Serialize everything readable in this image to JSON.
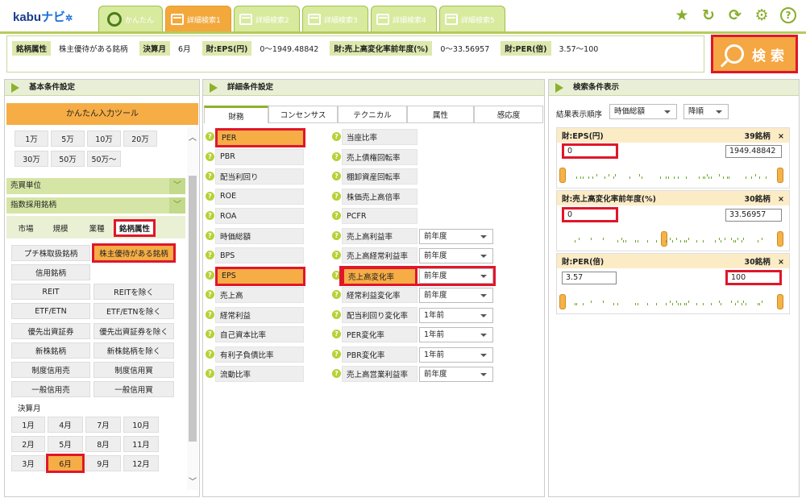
{
  "app": {
    "logo_a": "kabu",
    "logo_b": "ナビ",
    "tabs": [
      "かんたん",
      "詳細検索1",
      "詳細検索2",
      "詳細検索3",
      "詳細検索4",
      "詳細検索5"
    ]
  },
  "conditions": [
    {
      "label": "銘柄属性",
      "value": "株主優待がある銘柄"
    },
    {
      "label": "決算月",
      "value": "6月"
    },
    {
      "label": "財:EPS(円)",
      "value": "0〜1949.48842"
    },
    {
      "label": "財:売上高変化率前年度(%)",
      "value": "0〜33.56957"
    },
    {
      "label": "財:PER(倍)",
      "value": "3.57〜100"
    }
  ],
  "search_label": "検 索",
  "left": {
    "title": "基本条件設定",
    "easy_input": "かんたん入力ツール",
    "amounts": [
      "1万",
      "5万",
      "10万",
      "20万",
      "30万",
      "50万",
      "50万〜"
    ],
    "sections": [
      "売買単位",
      "指数採用銘柄"
    ],
    "subtabs": [
      "市場",
      "規模",
      "業種",
      "銘柄属性"
    ],
    "attrs": [
      "プチ株取扱銘柄",
      "株主優待がある銘柄",
      "信用銘柄",
      "REIT",
      "REITを除く",
      "ETF/ETN",
      "ETF/ETNを除く",
      "優先出資証券",
      "優先出資証券を除く",
      "新株銘柄",
      "新株銘柄を除く",
      "制度信用売",
      "制度信用買",
      "一般信用売",
      "一般信用買"
    ],
    "month_label": "決算月",
    "months": [
      "1月",
      "4月",
      "7月",
      "10月",
      "2月",
      "5月",
      "8月",
      "11月",
      "3月",
      "6月",
      "9月",
      "12月"
    ]
  },
  "middle": {
    "title": "詳細条件設定",
    "tabs": [
      "財務",
      "コンセンサス",
      "テクニカル",
      "属性",
      "感応度"
    ],
    "col1": [
      "PER",
      "PBR",
      "配当利回り",
      "ROE",
      "ROA",
      "時価総額",
      "BPS",
      "EPS",
      "売上高",
      "経常利益",
      "自己資本比率",
      "有利子負債比率",
      "流動比率"
    ],
    "col2": [
      "当座比率",
      "売上債権回転率",
      "棚卸資産回転率",
      "株価売上高倍率",
      "PCFR",
      "売上高利益率",
      "売上高経常利益率",
      "売上高変化率",
      "経常利益変化率",
      "配当利回り変化率",
      "PER変化率",
      "PBR変化率",
      "売上高営業利益率"
    ],
    "col2_selects": [
      "前年度",
      "前年度",
      "前年度",
      "前年度",
      "1年前",
      "1年前",
      "1年前",
      "前年度"
    ]
  },
  "right": {
    "title": "検索条件表示",
    "sort_label": "結果表示順序",
    "sort_value": "時価総額",
    "order_value": "降順",
    "cards": [
      {
        "name": "財:EPS(円)",
        "count": "39銘柄",
        "min": "0",
        "max": "1949.48842"
      },
      {
        "name": "財:売上高変化率前年度(%)",
        "count": "30銘柄",
        "min": "0",
        "max": "33.56957"
      },
      {
        "name": "財:PER(倍)",
        "count": "30銘柄",
        "min": "3.57",
        "max": "100"
      }
    ],
    "close_glyph": "×"
  },
  "colors": {
    "accent": "#f4a742",
    "highlight": "#e0162b",
    "green": "#8cb12c"
  }
}
